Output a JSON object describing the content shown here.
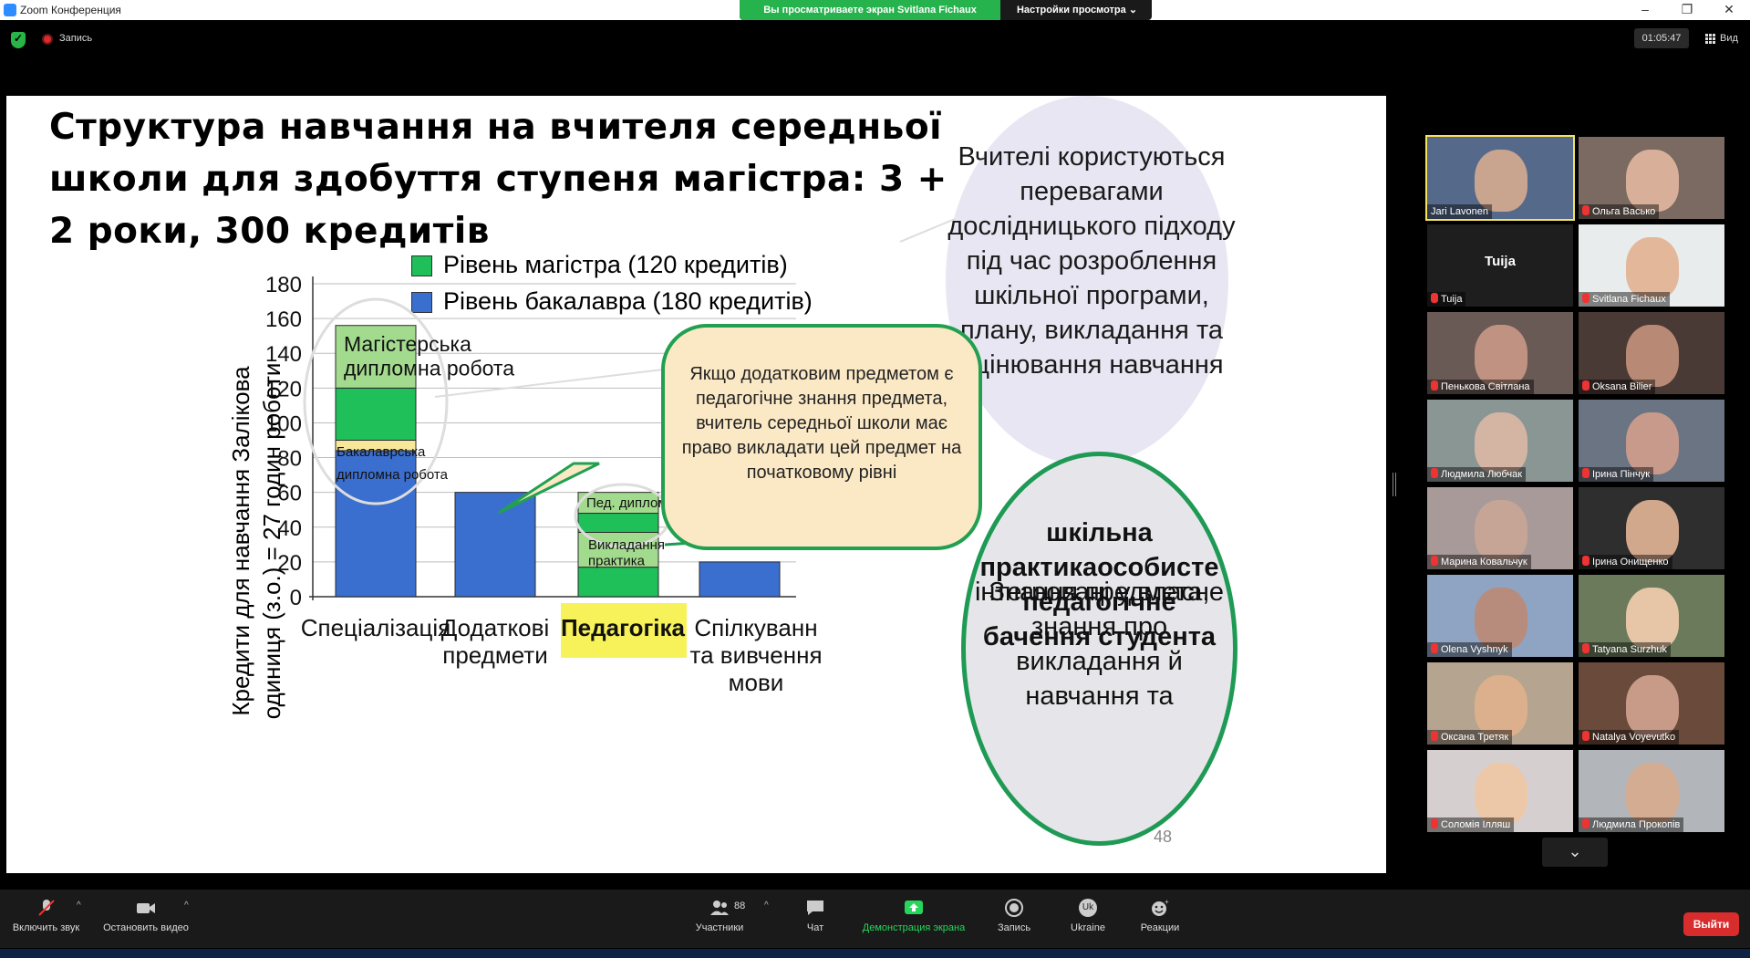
{
  "window": {
    "title": "Zoom Конференция"
  },
  "share_banner": {
    "viewing_label": "Вы просматриваете экран Svitlana Fichaux",
    "view_options_label": "Настройки просмотра ⌄"
  },
  "window_controls": {
    "minimize": "–",
    "maximize": "❐",
    "close": "✕"
  },
  "status": {
    "recording_label": "Запись",
    "timer": "01:05:47",
    "view_label": "Вид"
  },
  "slide": {
    "title": "Структура навчання на вчителя середньої школи для здобуття ступеня магістра: 3 + 2 роки, 300 кредитів",
    "legend": [
      {
        "label": "Рівень магістра (120 кредитів)",
        "color": "#1fbf5a"
      },
      {
        "label": "Рівень бакалавра (180 кредитів)",
        "color": "#3b6fcf"
      }
    ],
    "ylabel": "Кредити для навчання Залікова одиниця (з.о.) = 27 годин роботи",
    "bubble_research": "Вчителі користуються перевагами дослідницького підходу під час розроблення шкільної програми, плану, викладання та оцінювання навчання",
    "bubble_additional": "Якщо додатковим предметом є педагогічне знання предмета, вчитель середньої школи має право викладати цей предмет на початковому рівні",
    "bubble_integrated": {
      "part1": "Знання предмета, знання про викладання й навчання та ",
      "bold1": "шкільна практика",
      "part2": " інтегровані у власне ",
      "bold2": "особисте педагогічне бачення студента"
    },
    "page_number": "48"
  },
  "chart_data": {
    "type": "bar",
    "categories": [
      "Спеціалізація",
      "Додаткові предмети",
      "Педагогіка",
      "Спілкування та вивчення мови"
    ],
    "ylim": [
      0,
      180
    ],
    "yticks": [
      0,
      20,
      40,
      60,
      80,
      100,
      120,
      140,
      160,
      180
    ],
    "highlighted_category": "Педагогіка",
    "segments": [
      {
        "category": "Спеціалізація",
        "from": 0,
        "to": 84,
        "color": "#3b6fcf"
      },
      {
        "category": "Спеціалізація",
        "from": 84,
        "to": 90,
        "color": "#f7e79a"
      },
      {
        "category": "Спеціалізація",
        "from": 90,
        "to": 120,
        "color": "#1fbf5a"
      },
      {
        "category": "Спеціалізація",
        "from": 120,
        "to": 156,
        "color": "#a3db8e"
      },
      {
        "category": "Додаткові предмети",
        "from": 0,
        "to": 60,
        "color": "#3b6fcf"
      },
      {
        "category": "Педагогіка",
        "from": 0,
        "to": 17,
        "color": "#1fbf5a"
      },
      {
        "category": "Педагогіка",
        "from": 17,
        "to": 37,
        "color": "#a3db8e"
      },
      {
        "category": "Педагогіка",
        "from": 37,
        "to": 48,
        "color": "#1fbf5a"
      },
      {
        "category": "Педагогіка",
        "from": 48,
        "to": 60,
        "color": "#a3db8e"
      },
      {
        "category": "Спілкування та вивчення мови",
        "from": 0,
        "to": 20,
        "color": "#3b6fcf"
      }
    ],
    "annotations": [
      {
        "text": "Магістерська дипломна робота",
        "category": "Спеціалізація"
      },
      {
        "text": "Бакалаврська",
        "category": "Спеціалізація"
      },
      {
        "text": "дипломна робота",
        "category": "Спеціалізація"
      },
      {
        "text": "Пед. дипломна робота",
        "category": "Педагогіка"
      },
      {
        "text": "Викладання практика",
        "category": "Педагогіка"
      }
    ]
  },
  "participants_gallery": [
    {
      "name": "Jari Lavonen",
      "muted": false,
      "active": true,
      "bg": "#556a8a",
      "face": "#c9a48e"
    },
    {
      "name": "Ольга Васько",
      "muted": true,
      "bg": "#7a6a62",
      "face": "#d8b09a"
    },
    {
      "name": "Tuija",
      "muted": true,
      "no_video": true
    },
    {
      "name": "Svitlana Fichaux",
      "muted": true,
      "bg": "#e8ecec",
      "face": "#e3b79a"
    },
    {
      "name": "Пенькова Світлана",
      "muted": true,
      "bg": "#6a5a56",
      "face": "#c09282"
    },
    {
      "name": "Oksana Bilier",
      "muted": true,
      "bg": "#4a3a36",
      "face": "#b88a76"
    },
    {
      "name": "Людмила Любчак",
      "muted": true,
      "bg": "#8a9694",
      "face": "#d4b5a4"
    },
    {
      "name": "Ірина Пінчук",
      "muted": true,
      "bg": "#6a7482",
      "face": "#c79a8c"
    },
    {
      "name": "Марина Ковальчук",
      "muted": true,
      "bg": "#a89a98",
      "face": "#c6a596"
    },
    {
      "name": "Ірина Онищенко",
      "muted": true,
      "bg": "#2e2e2e",
      "face": "#d2a88c"
    },
    {
      "name": "Olena Vyshnyk",
      "muted": true,
      "bg": "#8ea4c2",
      "face": "#b88c7c"
    },
    {
      "name": "Tatyana Surzhuk",
      "muted": true,
      "bg": "#6a7a5a",
      "face": "#e6c6a6"
    },
    {
      "name": "Оксана Третяк",
      "muted": true,
      "bg": "#b4a490",
      "face": "#dcb08c"
    },
    {
      "name": "Natalya Voyevutko",
      "muted": true,
      "bg": "#6a4a3a",
      "face": "#c89a88"
    },
    {
      "name": "Соломія Ілляш",
      "muted": true,
      "bg": "#d6cfd0",
      "face": "#ecc8a8"
    },
    {
      "name": "Людмила Прокопів",
      "muted": true,
      "bg": "#b2b6ba",
      "face": "#d4ac92"
    }
  ],
  "gallery_more_icon": "chevron-down-icon",
  "toolbar": {
    "mute_label": "Включить звук",
    "video_label": "Остановить видео",
    "participants_label": "Участники",
    "participants_count": "88",
    "chat_label": "Чат",
    "share_label": "Демонстрация экрана",
    "record_label": "Запись",
    "ukraine_label": "Ukraine",
    "ukraine_badge": "Uk",
    "reactions_label": "Реакции",
    "leave_label": "Выйти",
    "caret": "^"
  }
}
